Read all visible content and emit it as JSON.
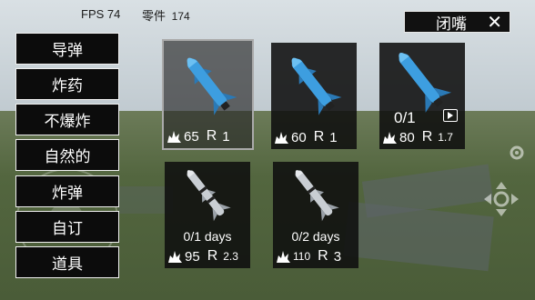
{
  "hud": {
    "fps_label": "FPS",
    "fps_value": "74",
    "parts_label": "零件",
    "parts_value": "174"
  },
  "close_button": {
    "label": "闭嘴",
    "icon": "close-icon"
  },
  "categories": [
    {
      "label": "导弹"
    },
    {
      "label": "炸药"
    },
    {
      "label": "不爆炸"
    },
    {
      "label": "自然的"
    },
    {
      "label": "炸弹"
    },
    {
      "label": "自订"
    },
    {
      "label": "道具"
    }
  ],
  "items": [
    {
      "power": "65",
      "r_label": "R",
      "range": "1",
      "rocket": "blue-missile",
      "selected": true
    },
    {
      "power": "60",
      "r_label": "R",
      "range": "1",
      "rocket": "blue-missile",
      "selected": false
    },
    {
      "power": "80",
      "r_label": "R",
      "range": "1.7",
      "rocket": "blue-missile",
      "count": "0/1",
      "badge_icon": "video-ad-icon"
    },
    {
      "power": "95",
      "r_label": "R",
      "range": "2.3",
      "rocket": "grey-cruise-missile",
      "days": "0/1 days"
    },
    {
      "power": "110",
      "r_label": "R",
      "range": "3",
      "rocket": "grey-cruise-missile",
      "days": "0/2 days"
    }
  ],
  "colors": {
    "blue_missile": "#3d9ee0",
    "grey_missile": "#c9ced3",
    "card_bg": "#141414",
    "button_bg": "#0c0c0c"
  }
}
